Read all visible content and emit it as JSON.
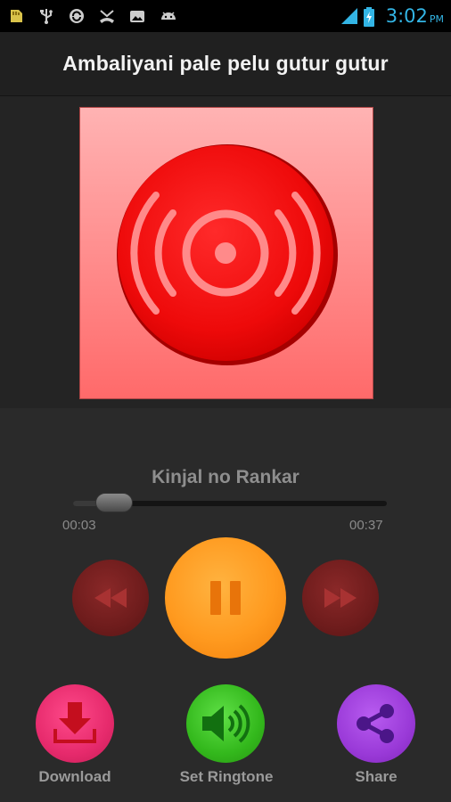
{
  "status_bar": {
    "time": "3:02",
    "ampm": "PM",
    "icons": [
      "sd-card-icon",
      "usb-icon",
      "sync-icon",
      "missed-call-icon",
      "gallery-icon",
      "android-icon",
      "signal-icon",
      "battery-charging-icon"
    ]
  },
  "header": {
    "title": "Ambaliyani pale pelu gutur gutur"
  },
  "player": {
    "track_name": "Kinjal no Rankar",
    "current_time": "00:03",
    "total_time": "00:37",
    "progress": 0.08
  },
  "actions": {
    "download_label": "Download",
    "ringtone_label": "Set Ringtone",
    "share_label": "Share"
  },
  "colors": {
    "accent": "#33b5e5",
    "play": "#ff9a1f",
    "prev_next": "#6e1c1c",
    "download": "#e62a6c",
    "ringtone": "#33b81c",
    "share": "#9a3ad8"
  }
}
